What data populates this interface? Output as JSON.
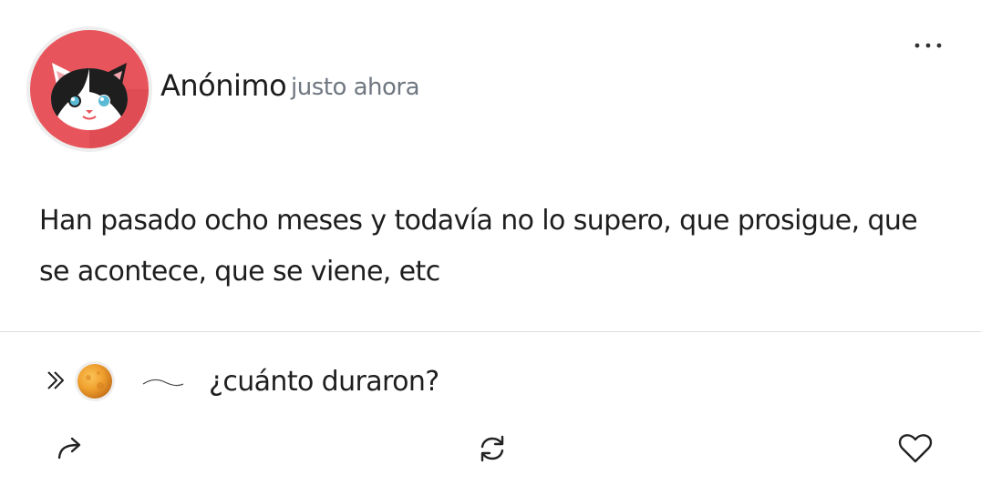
{
  "post": {
    "author": "Anónimo",
    "time": "justo ahora",
    "body": "Han pasado ocho meses y todavía no lo supero, que prosigue, que se acontece, que se viene, etc"
  },
  "icons": {
    "avatar": "cat-face-avatar",
    "more": "more-dots-icon",
    "reply_chevron": "double-chevron-right-icon",
    "reply_avatar": "orange-planet-avatar",
    "share": "share-arrow-icon",
    "repost": "repost-cycle-icon",
    "like": "heart-icon"
  },
  "reply": {
    "text": "¿cuánto duraron?"
  },
  "colors": {
    "avatar_bg": "#e8545b",
    "avatar_ring": "#eeeeee",
    "time_text": "#6f7780",
    "divider": "#dcdcdc"
  }
}
